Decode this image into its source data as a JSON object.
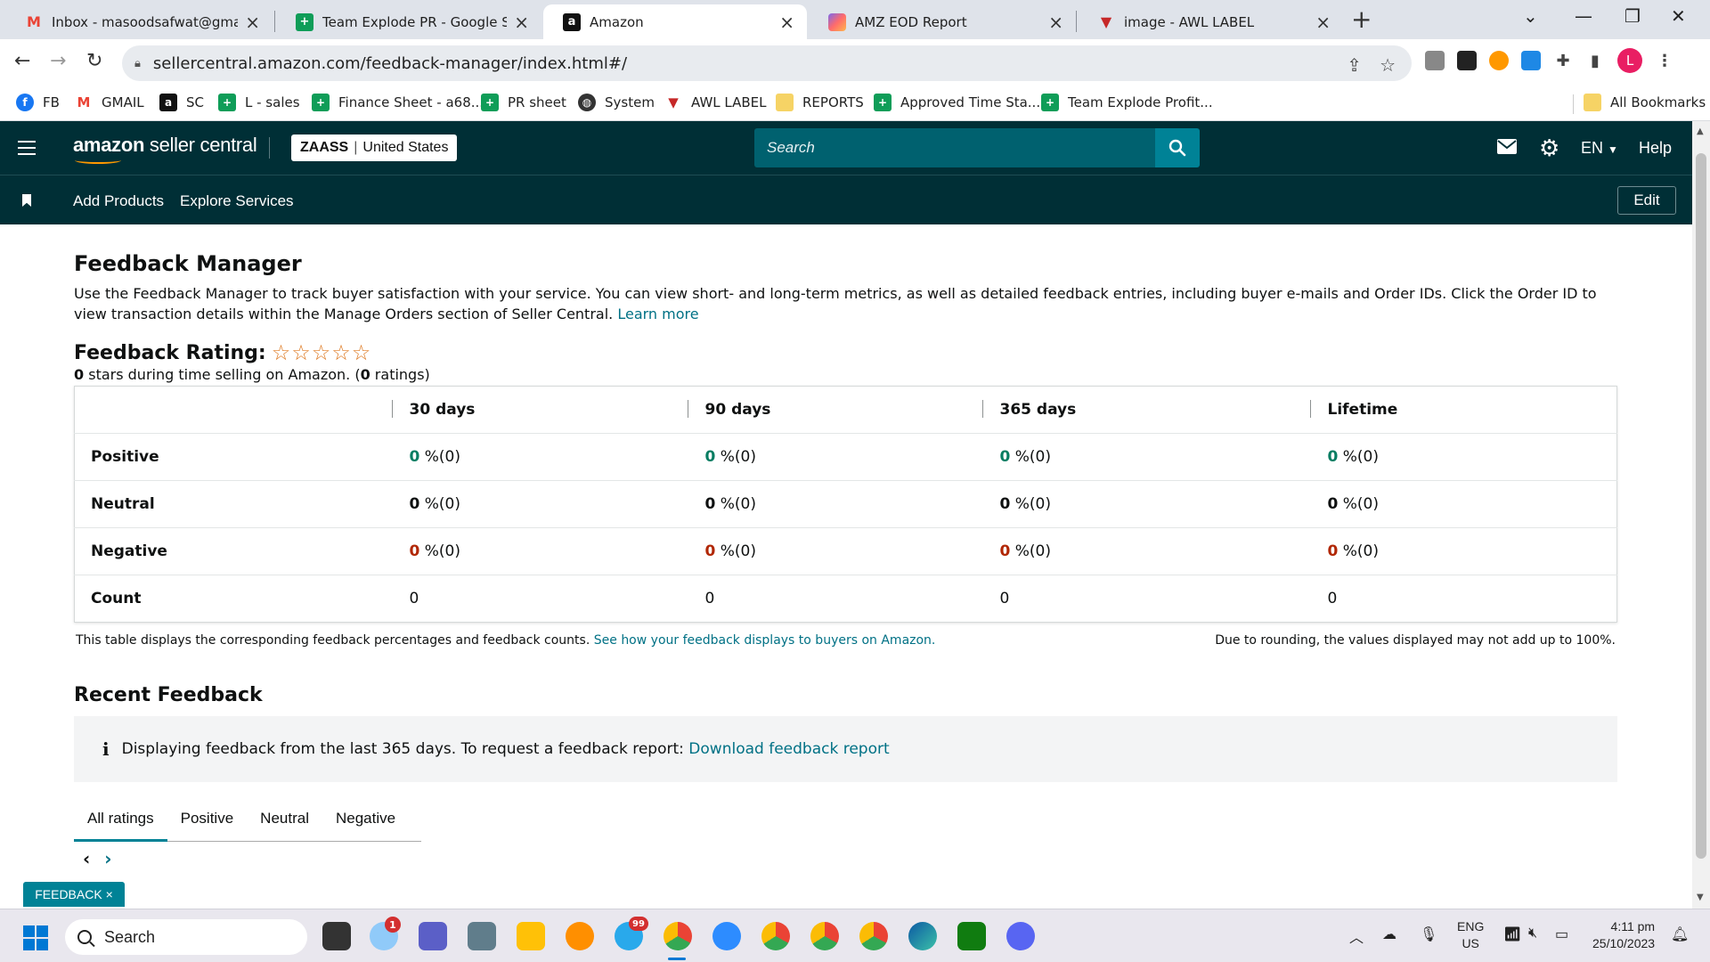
{
  "browser": {
    "tabs": [
      {
        "title": "Inbox - masoodsafwat@gmail.co",
        "icon": "gmail-icon",
        "active": false
      },
      {
        "title": "Team Explode PR - Google Shee",
        "icon": "sheets-icon",
        "active": false
      },
      {
        "title": "Amazon",
        "icon": "amazon-icon",
        "active": true
      },
      {
        "title": "AMZ EOD Report",
        "icon": "clickup-icon",
        "active": false
      },
      {
        "title": "image - AWL LABEL",
        "icon": "awl-icon",
        "active": false
      }
    ],
    "url": "sellercentral.amazon.com/feedback-manager/index.html#/",
    "profile_initial": "L",
    "bookmarks": [
      {
        "label": "FB",
        "icon": "facebook-icon"
      },
      {
        "label": "GMAIL",
        "icon": "gmail-icon"
      },
      {
        "label": "SC",
        "icon": "amazon-icon"
      },
      {
        "label": "L - sales",
        "icon": "sheets-icon"
      },
      {
        "label": "Finance Sheet - a68...",
        "icon": "sheets-icon"
      },
      {
        "label": "PR sheet",
        "icon": "sheets-icon"
      },
      {
        "label": "System",
        "icon": "globe-icon"
      },
      {
        "label": "AWL LABEL",
        "icon": "awl-icon"
      },
      {
        "label": "REPORTS",
        "icon": "folder-icon"
      },
      {
        "label": "Approved Time Sta...",
        "icon": "sheets-icon"
      },
      {
        "label": "Team Explode Profit...",
        "icon": "sheets-icon"
      }
    ],
    "all_bookmarks": "All Bookmarks"
  },
  "header": {
    "brand_bold": "amazon",
    "brand_rest": " seller central",
    "store_name": "ZAASS",
    "marketplace": "United States",
    "search_placeholder": "Search",
    "language": "EN",
    "help": "Help",
    "nav": [
      "Add Products",
      "Explore Services"
    ],
    "edit": "Edit"
  },
  "page": {
    "title": "Feedback Manager",
    "intro": "Use the Feedback Manager to track buyer satisfaction with your service. You can view short- and long-term metrics, as well as detailed feedback entries, including buyer e-mails and Order IDs. Click the Order ID to view transaction details within the Manage Orders section of Seller Central.",
    "learn_more": "Learn more",
    "rating_label": "Feedback Rating:",
    "stars": "☆☆☆☆☆",
    "rating_sub_stars": "0",
    "rating_sub_mid": " stars during time selling on Amazon. (",
    "rating_sub_count": "0",
    "rating_sub_end": " ratings)",
    "table": {
      "columns": [
        "30 days",
        "90 days",
        "365 days",
        "Lifetime"
      ],
      "rows": [
        {
          "label": "Positive",
          "cells": [
            [
              "0",
              " %(0)"
            ],
            [
              "0",
              " %(0)"
            ],
            [
              "0",
              " %(0)"
            ],
            [
              "0",
              " %(0)"
            ]
          ]
        },
        {
          "label": "Neutral",
          "cells": [
            [
              "0",
              " %(0)"
            ],
            [
              "0",
              " %(0)"
            ],
            [
              "0",
              " %(0)"
            ],
            [
              "0",
              " %(0)"
            ]
          ]
        },
        {
          "label": "Negative",
          "cells": [
            [
              "0",
              " %(0)"
            ],
            [
              "0",
              " %(0)"
            ],
            [
              "0",
              " %(0)"
            ],
            [
              "0",
              " %(0)"
            ]
          ]
        },
        {
          "label": "Count",
          "cells": [
            "0",
            "0",
            "0",
            "0"
          ]
        }
      ]
    },
    "table_note": "This table displays the corresponding feedback percentages and feedback counts.",
    "table_note_link": "See how your feedback displays to buyers on Amazon.",
    "table_note_right": "Due to rounding, the values displayed may not add up to 100%.",
    "recent_title": "Recent Feedback",
    "info_text": "Displaying feedback from the last 365 days. To request a feedback report:",
    "info_link": "Download feedback report",
    "rating_tabs": [
      "All ratings",
      "Positive",
      "Neutral",
      "Negative"
    ],
    "feedback_badge": "FEEDBACK"
  },
  "taskbar": {
    "search": "Search",
    "lang_top": "ENG",
    "lang_bottom": "US",
    "time": "4:11 pm",
    "date": "25/10/2023",
    "badge_weather": "1",
    "badge_telegram": "99"
  },
  "colors": {
    "header_bg": "#002f36",
    "search_bg": "#00616f",
    "search_btn": "#008296",
    "link": "#007185",
    "positive": "#067d62",
    "negative": "#b12704",
    "star": "#de7921"
  }
}
